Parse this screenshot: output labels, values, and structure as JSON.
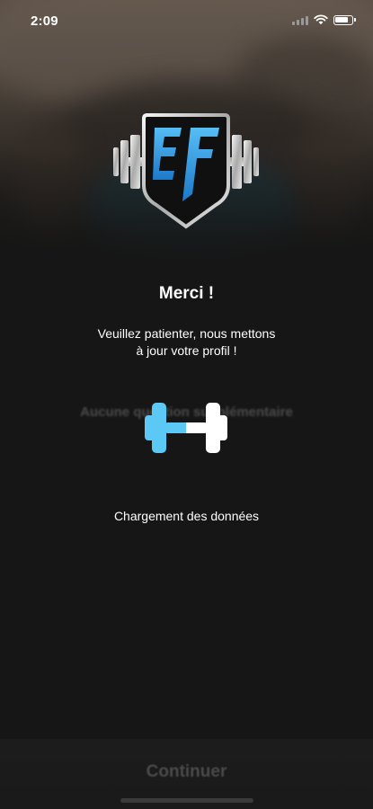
{
  "status_bar": {
    "time": "2:09",
    "battery_level": 0.9
  },
  "logo": {
    "letters": "EF",
    "accent_color": "#2f9fe8"
  },
  "content": {
    "title": "Merci !",
    "subtitle_line1": "Veuillez patienter, nous mettons",
    "subtitle_line2": "à jour votre profil !",
    "background_text": "Aucune question supplémentaire",
    "loading_text": "Chargement des données"
  },
  "loader": {
    "icon": "dumbbell-icon",
    "progress": 0.5,
    "color": "#5bc8f5"
  },
  "footer": {
    "continue_label": "Continuer"
  }
}
